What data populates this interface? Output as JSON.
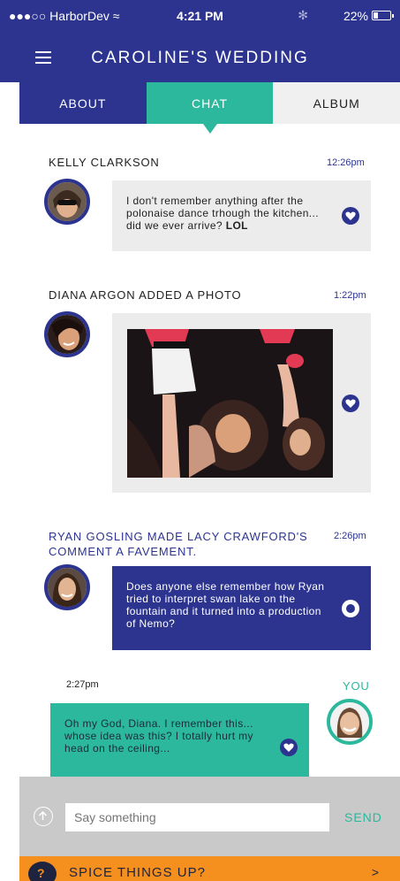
{
  "status": {
    "carrier": "●●●○○ HarborDev ≈",
    "time": "4:21 PM",
    "bluetooth": "✻",
    "battery": "22%"
  },
  "header": {
    "title": "CAROLINE'S WEDDING"
  },
  "tabs": [
    {
      "label": "ABOUT"
    },
    {
      "label": "CHAT",
      "active": true
    },
    {
      "label": "ALBUM"
    }
  ],
  "feed": {
    "msg1": {
      "sender": "KELLY CLARKSON",
      "time": "12:26pm",
      "text_a": "I don't remember anything after the polonaise dance trhough the kitchen... did we ever arrive? ",
      "text_b": "LOL"
    },
    "msg2": {
      "sender": "DIANA ARGON ADDED A PHOTO",
      "time": "1:22pm"
    },
    "msg3": {
      "sender": "RYAN GOSLING MADE LACY CRAWFORD'S COMMENT A FAVEMENT.",
      "time": "2:26pm",
      "text": "Does anyone else remember how Ryan tried to interpret swan lake on the fountain and it turned into a production of Nemo?"
    },
    "msg4": {
      "time": "2:27pm",
      "you_label": "YOU",
      "text": "Oh my God, Diana. I remember this... whose idea was this? I totally hurt my head on the ceiling..."
    }
  },
  "composer": {
    "placeholder": "Say something",
    "send_label": "SEND"
  },
  "promo": {
    "label": "SPICE THINGS UP?",
    "arrow": ">"
  },
  "colors": {
    "navy": "#2c3490",
    "teal": "#2bb89c",
    "orange": "#f5901e",
    "grey": "#ececec"
  },
  "icons": [
    "menu-icon",
    "heart-icon",
    "up-arrow-icon",
    "battery-icon",
    "spice-logo-icon"
  ]
}
